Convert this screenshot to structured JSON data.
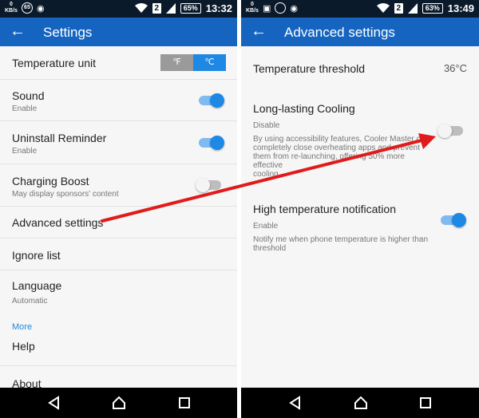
{
  "left": {
    "status": {
      "kbs_top": "0",
      "kbs_bottom": "KB/s",
      "badge": "65",
      "sim": "2",
      "battery": "65%",
      "time": "13:32"
    },
    "appbar": {
      "back": "←",
      "title": "Settings"
    },
    "temperature_unit": {
      "label": "Temperature unit",
      "option_f": "℉",
      "option_c": "℃",
      "selected": "℃"
    },
    "items": [
      {
        "title": "Sound",
        "subtitle": "Enable",
        "toggle": "on"
      },
      {
        "title": "Uninstall Reminder",
        "subtitle": "Enable",
        "toggle": "on"
      },
      {
        "title": "Charging Boost",
        "subtitle": "May display sponsors' content",
        "toggle": "off"
      }
    ],
    "advanced": "Advanced settings",
    "ignore": "Ignore list",
    "language": {
      "title": "Language",
      "subtitle": "Automatic"
    },
    "more_header": "More",
    "help": "Help",
    "about": "About"
  },
  "right": {
    "status": {
      "kbs_top": "0",
      "kbs_bottom": "KB/s",
      "sim": "2",
      "battery": "63%",
      "time": "13:49"
    },
    "appbar": {
      "back": "←",
      "title": "Advanced settings"
    },
    "threshold": {
      "title": "Temperature threshold",
      "value": "36°C"
    },
    "cooling": {
      "title": "Long-lasting Cooling",
      "subtitle": "Disable",
      "desc_1": "By using accessibility features, Cooler Master can",
      "desc_2": "completely close overheating apps and prevent",
      "desc_3": "them from re-launching, offering 50% more effective",
      "desc_4": "cooling.",
      "toggle": "off"
    },
    "notification": {
      "title": "High temperature notification",
      "subtitle": "Enable",
      "desc_1": "Notify me when phone temperature is higher than",
      "desc_2": "threshold",
      "toggle": "on"
    }
  },
  "colors": {
    "appbar": "#1565c0",
    "accent": "#1e88e5",
    "arrow": "#e01b1b",
    "statusbar": "#0a1a2a",
    "navbar": "#000000"
  }
}
